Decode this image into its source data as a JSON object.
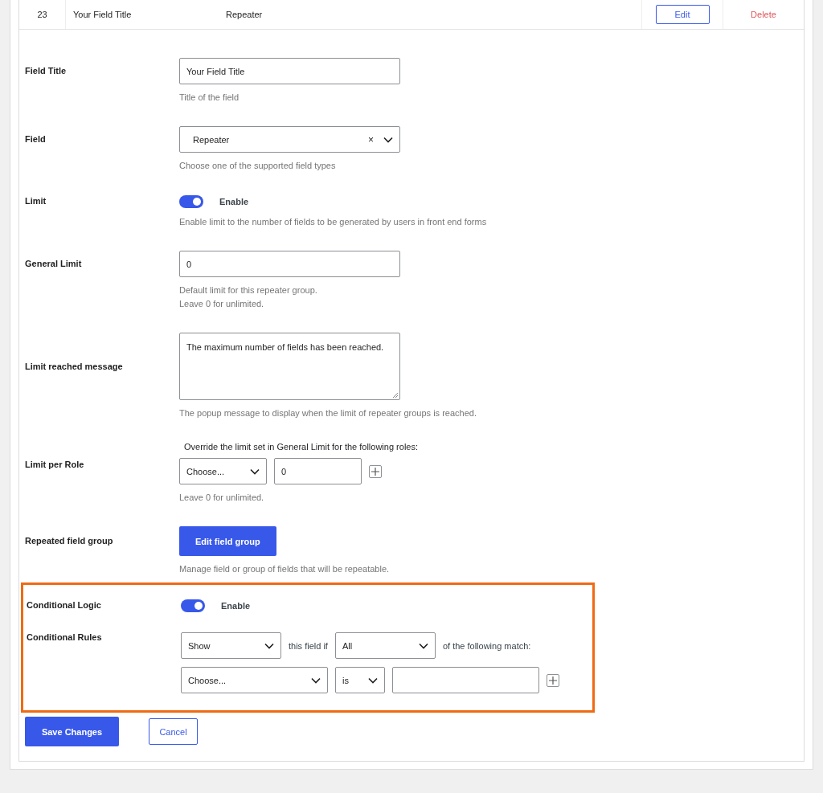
{
  "field_row": {
    "number": "23",
    "title": "Your Field Title",
    "type": "Repeater",
    "edit": "Edit",
    "delete": "Delete"
  },
  "settings": [
    {
      "kind": "text",
      "label": "Field Title",
      "value": "Your Field Title",
      "description": [
        "Title of the field"
      ]
    },
    {
      "kind": "select_clear",
      "label": "Field",
      "value": "Repeater",
      "clear": "×",
      "description": [
        "Choose one of the supported field types"
      ]
    },
    {
      "kind": "toggle",
      "label": "Limit",
      "on": true,
      "toggle_label": "Enable",
      "description": [
        "Enable limit to the number of fields to be generated by users in front end forms"
      ]
    },
    {
      "kind": "text",
      "label": "General Limit",
      "value": "0",
      "description": [
        "Default limit for this repeater group.",
        "Leave 0 for unlimited."
      ]
    },
    {
      "kind": "textarea",
      "label": "Limit reached message",
      "value": "The maximum number of fields has been reached.",
      "description": [
        "The popup message to display when the limit of repeater groups is reached."
      ]
    },
    {
      "kind": "role_limit",
      "label": "Limit per Role",
      "intro": "Override the limit set in General Limit for the following roles:",
      "role": "Choose...",
      "value": "0",
      "description": [
        "Leave 0 for unlimited."
      ]
    },
    {
      "kind": "button",
      "label": "Repeated field group",
      "button": "Edit field group",
      "description": [
        "Manage field or group of fields that will be repeatable."
      ]
    }
  ],
  "conditional": {
    "highlighted": true,
    "logic": {
      "label": "Conditional Logic",
      "on": true,
      "toggle_label": "Enable"
    },
    "rules": {
      "label": "Conditional Rules",
      "action": "Show",
      "text_1": "this field if",
      "match": "All",
      "text_2": "of the following match:",
      "field": "Choose...",
      "operator": "is"
    }
  },
  "actions": {
    "save": "Save Changes",
    "cancel": "Cancel"
  }
}
